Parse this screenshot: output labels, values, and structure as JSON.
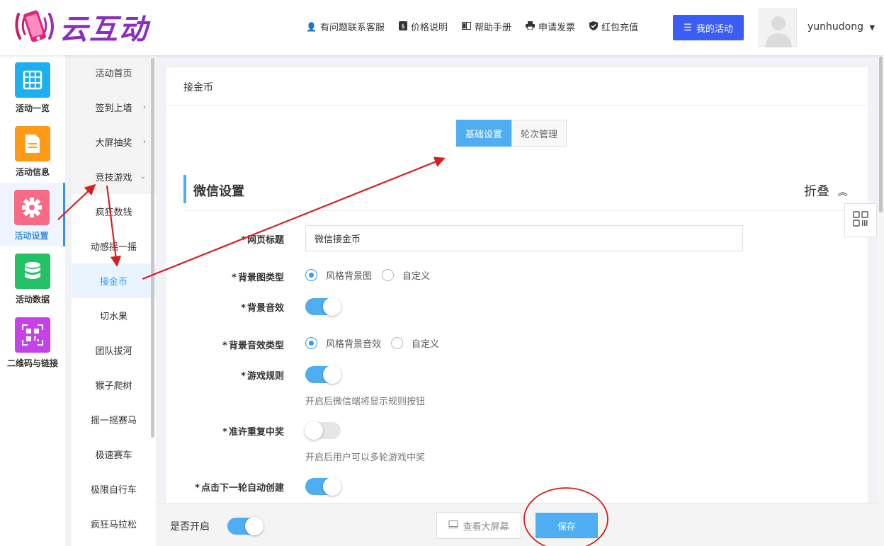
{
  "header": {
    "logo_text": "云互动",
    "nav": [
      {
        "icon": "person-add-icon",
        "label": "有问题联系客服"
      },
      {
        "icon": "dollar-icon",
        "label": "价格说明"
      },
      {
        "icon": "book-icon",
        "label": "帮助手册"
      },
      {
        "icon": "printer-icon",
        "label": "申请发票"
      },
      {
        "icon": "shield-icon",
        "label": "红包充值"
      }
    ],
    "my_activity": "我的活动",
    "username": "yunhudong"
  },
  "iconbar": [
    {
      "label": "活动一览",
      "color": "#1eaff0",
      "icon": "grid-icon"
    },
    {
      "label": "活动信息",
      "color": "#ff9a18",
      "icon": "document-icon"
    },
    {
      "label": "活动设置",
      "color": "#f76b86",
      "icon": "gear-icon",
      "active": true
    },
    {
      "label": "活动数据",
      "color": "#25c165",
      "icon": "database-icon"
    },
    {
      "label": "二维码与链接",
      "color": "#c541e8",
      "icon": "qrcode-icon"
    }
  ],
  "submenu": [
    {
      "label": "活动首页"
    },
    {
      "label": "签到上墙",
      "chevron": "›"
    },
    {
      "label": "大屏抽奖",
      "chevron": "›"
    },
    {
      "label": "竞技游戏",
      "chevron": "⌄"
    },
    {
      "label": "疯狂数钱"
    },
    {
      "label": "动感摇一摇"
    },
    {
      "label": "接金币",
      "active": true
    },
    {
      "label": "切水果"
    },
    {
      "label": "团队拔河"
    },
    {
      "label": "猴子爬树"
    },
    {
      "label": "摇一摇赛马"
    },
    {
      "label": "极速赛车"
    },
    {
      "label": "极限自行车"
    },
    {
      "label": "疯狂马拉松"
    }
  ],
  "main": {
    "title": "接金币",
    "tabs": [
      {
        "label": "基础设置",
        "active": true
      },
      {
        "label": "轮次管理",
        "active": false
      }
    ],
    "section_title": "微信设置",
    "collapse_label": "折叠",
    "fields": {
      "page_title": {
        "label": "网页标题",
        "value": "微信接金币"
      },
      "bg_type": {
        "label": "背景图类型",
        "options": [
          "风格背景图",
          "自定义"
        ],
        "selected": 0
      },
      "bg_sound": {
        "label": "背景音效",
        "on": true
      },
      "bg_sound_type": {
        "label": "背景音效类型",
        "options": [
          "风格背景音效",
          "自定义"
        ],
        "selected": 0
      },
      "game_rules": {
        "label": "游戏规则",
        "on": true,
        "hint": "开启后微信端将显示规则按钮"
      },
      "repeat_win": {
        "label": "准许重复中奖",
        "on": false,
        "hint": "开启后用户可以多轮游戏中奖"
      },
      "auto_next": {
        "label": "点击下一轮自动创建",
        "on": true
      }
    },
    "required_mark": "*"
  },
  "bottom": {
    "enable_label": "是否开启",
    "enable_on": true,
    "view_screen": "查看大屏幕",
    "save": "保存"
  },
  "colors": {
    "accent": "#4faef2",
    "primary": "#3a5ef5",
    "annotation_red": "#d62020"
  }
}
